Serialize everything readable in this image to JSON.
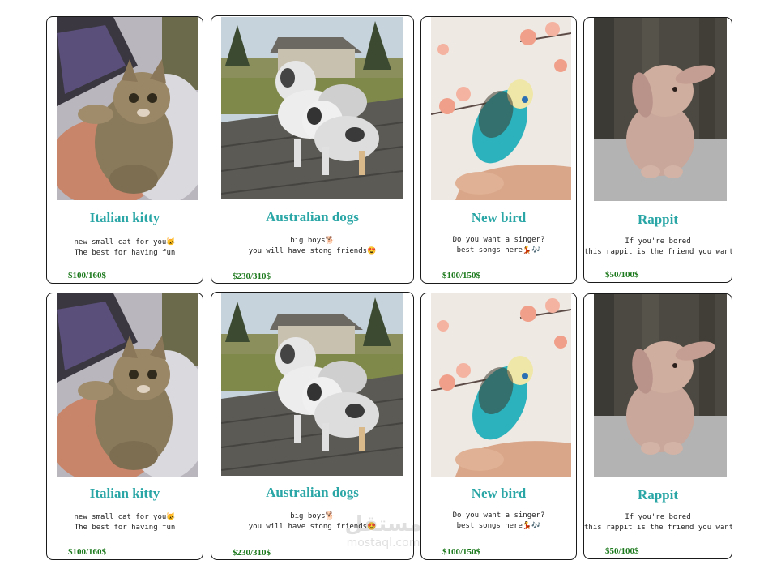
{
  "rows": [
    {
      "cards": [
        {
          "title": "Italian kitty",
          "line1": "new small cat for you🐱",
          "line2": "The best for having fun",
          "price": "$100/160$",
          "photo": "cat-photo"
        },
        {
          "title": "Australian dogs",
          "line1": "big boys🐕",
          "line2": "you will have stong friends😍",
          "price": "$230/310$",
          "photo": "dogs-photo"
        },
        {
          "title": "New bird",
          "line1": "Do you want a singer?",
          "line2": "best songs here💃🎶",
          "price": "$100/150$",
          "photo": "bird-photo"
        },
        {
          "title": "Rappit",
          "line1": "If you're bored",
          "line2": "this rappit is the friend you want",
          "price": "$50/100$",
          "photo": "rabbit-photo"
        }
      ]
    },
    {
      "cards": [
        {
          "title": "Italian kitty",
          "line1": "new small cat for you🐱",
          "line2": "The best for having fun",
          "price": "$100/160$",
          "photo": "cat-photo"
        },
        {
          "title": "Australian dogs",
          "line1": "big boys🐕",
          "line2": "you will have stong friends😍",
          "price": "$230/310$",
          "photo": "dogs-photo"
        },
        {
          "title": "New bird",
          "line1": "Do you want a singer?",
          "line2": "best songs here💃🎶",
          "price": "$100/150$",
          "photo": "bird-photo"
        },
        {
          "title": "Rappit",
          "line1": "If you're bored",
          "line2": "this rappit is the friend you want",
          "price": "$50/100$",
          "photo": "rabbit-photo"
        }
      ]
    }
  ],
  "watermark": {
    "arabic": "مستقل",
    "latin": "mostaql.com"
  },
  "colors": {
    "title": "#2aa6a6",
    "price": "#1e7a1e",
    "border": "#1a1a1a"
  }
}
